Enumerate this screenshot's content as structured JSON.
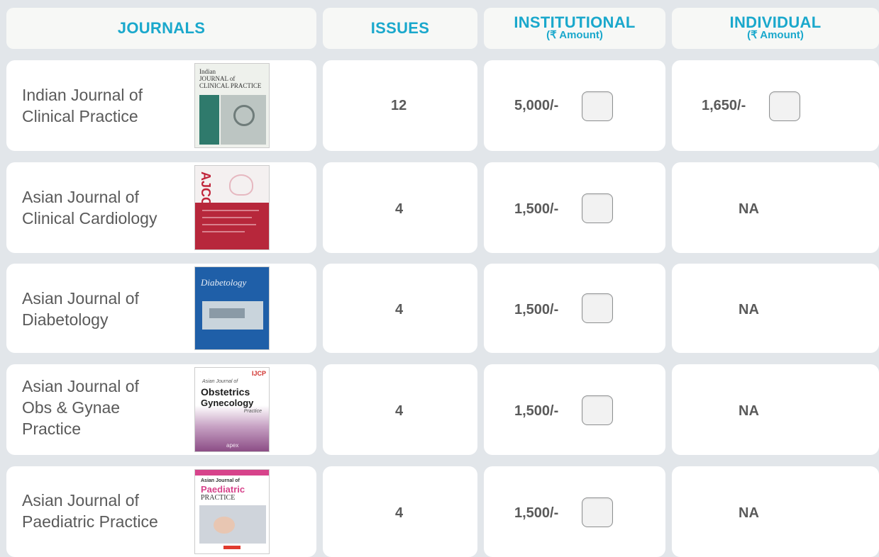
{
  "header": {
    "journals": "JOURNALS",
    "issues": "ISSUES",
    "institutional": "INSTITUTIONAL",
    "institutional_sub": "(₹ Amount)",
    "individual": "INDIVIDUAL",
    "individual_sub": "(₹ Amount)"
  },
  "rows": [
    {
      "name_line1": "Indian Journal of",
      "name_line2": "Clinical Practice",
      "name_line3": "",
      "issues": "12",
      "institutional": "5,000/-",
      "individual": "1,650/-",
      "cover": {
        "line1": "Indian",
        "line2": "JOURNAL of",
        "line3": "CLINICAL PRACTICE"
      }
    },
    {
      "name_line1": "Asian Journal of",
      "name_line2": "Clinical Cardiology",
      "name_line3": "",
      "issues": "4",
      "institutional": "1,500/-",
      "individual": "NA",
      "cover": {
        "line1": "AJCC"
      }
    },
    {
      "name_line1": "Asian Journal of",
      "name_line2": "Diabetology",
      "name_line3": "",
      "issues": "4",
      "institutional": "1,500/-",
      "individual": "NA",
      "cover": {
        "line1": "Diabetology"
      }
    },
    {
      "name_line1": "Asian Journal of",
      "name_line2": "Obs & Gynae",
      "name_line3": "Practice",
      "issues": "4",
      "institutional": "1,500/-",
      "individual": "NA",
      "cover": {
        "line1": "Asian Journal of",
        "line2": "Obstetrics",
        "line3": "Gynecology",
        "line4": "Practice",
        "footer": "apex",
        "badge": "IJCP"
      }
    },
    {
      "name_line1": "Asian Journal of",
      "name_line2": "Paediatric Practice",
      "name_line3": "",
      "issues": "4",
      "institutional": "1,500/-",
      "individual": "NA",
      "cover": {
        "line1": "Asian Journal of",
        "line2": "Paediatric",
        "line3": "PRACTICE"
      }
    }
  ],
  "colors": {
    "accent": "#1aa8cc",
    "text": "#5a5a5a",
    "background": "#e2e6ea"
  }
}
